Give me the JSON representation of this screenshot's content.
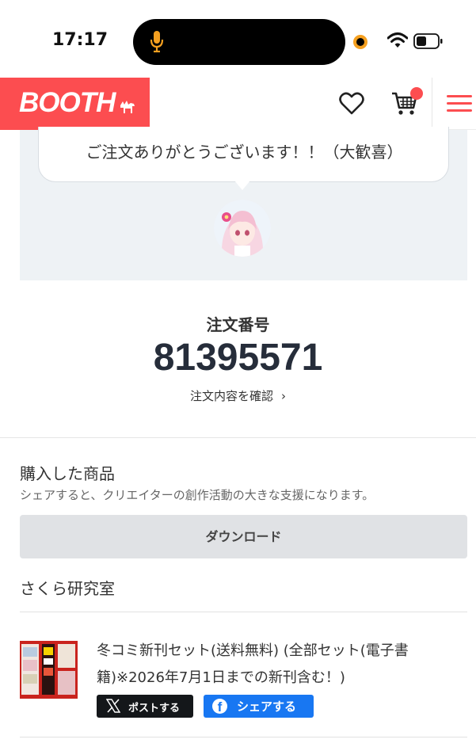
{
  "status_bar": {
    "time": "17:17",
    "icons": [
      "microphone-icon",
      "recording-dot-icon",
      "wifi-icon",
      "battery-icon"
    ]
  },
  "header": {
    "logo_text": "BOOTH",
    "icons": [
      "heart-icon",
      "cart-icon",
      "menu-icon"
    ],
    "colors": {
      "brand": "#fc4d50"
    }
  },
  "hero": {
    "message": "ご注文ありがとうございます！！（大歓喜）"
  },
  "order": {
    "label": "注文番号",
    "number": "81395571",
    "detail_link": "注文内容を確認"
  },
  "purchased": {
    "title": "購入した商品",
    "subtitle": "シェアすると、クリエイターの創作活動の大きな支援になります。",
    "download_label": "ダウンロード",
    "shop_name": "さくら研究室",
    "item": {
      "title": "冬コミ新刊セット(送料無料) (全部セット(電子書籍)※2026年7月1日までの新刊含む！)",
      "share_x_label": "ポストする",
      "share_fb_label": "シェアする",
      "colors": {
        "x": "#14171a",
        "facebook": "#1877f2"
      }
    }
  }
}
